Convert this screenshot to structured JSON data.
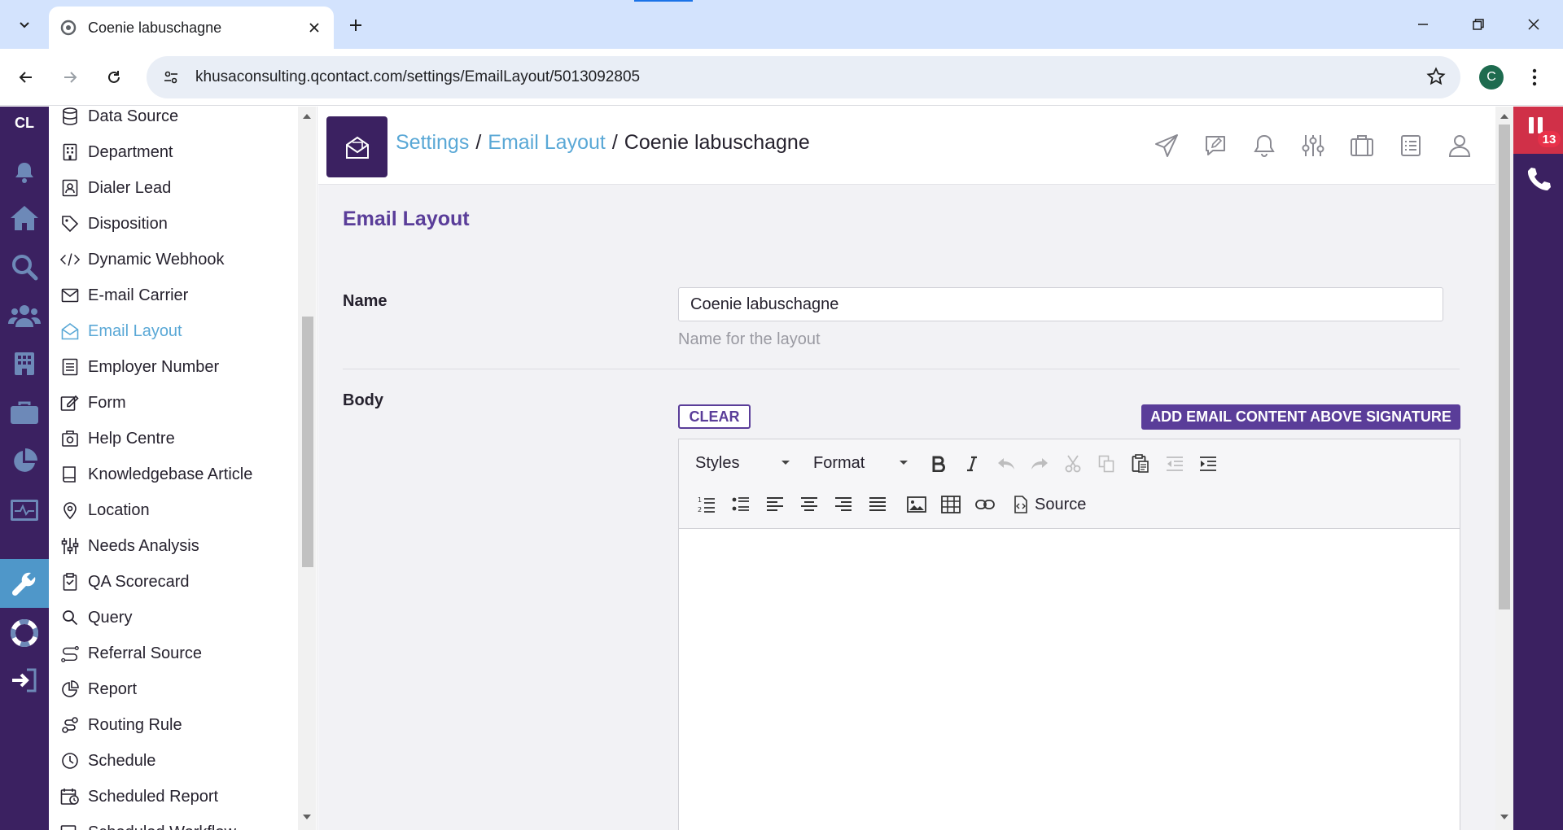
{
  "browser": {
    "tab_title": "Coenie labuschagne",
    "url": "khusaconsulting.qcontact.com/settings/EmailLayout/5013092805",
    "profile_initial": "C"
  },
  "rail": {
    "logo": "CL",
    "items": [
      "bell-icon",
      "home-icon",
      "search-icon",
      "people-icon",
      "building-icon",
      "briefcase-icon",
      "pie-chart-icon",
      "monitor-icon",
      "wrench-icon",
      "lifebuoy-icon",
      "logout-icon"
    ]
  },
  "menu": {
    "items": [
      {
        "label": "Data Source",
        "icon": "database-icon"
      },
      {
        "label": "Department",
        "icon": "building-icon"
      },
      {
        "label": "Dialer Lead",
        "icon": "contact-card-icon"
      },
      {
        "label": "Disposition",
        "icon": "tag-icon"
      },
      {
        "label": "Dynamic Webhook",
        "icon": "code-icon"
      },
      {
        "label": "E-mail Carrier",
        "icon": "envelope-icon"
      },
      {
        "label": "Email Layout",
        "icon": "envelope-open-icon",
        "active": true
      },
      {
        "label": "Employer Number",
        "icon": "list-icon"
      },
      {
        "label": "Form",
        "icon": "form-edit-icon"
      },
      {
        "label": "Help Centre",
        "icon": "help-centre-icon"
      },
      {
        "label": "Knowledgebase Article",
        "icon": "book-icon"
      },
      {
        "label": "Location",
        "icon": "map-pin-icon"
      },
      {
        "label": "Needs Analysis",
        "icon": "sliders-icon"
      },
      {
        "label": "QA Scorecard",
        "icon": "clipboard-icon"
      },
      {
        "label": "Query",
        "icon": "search-icon"
      },
      {
        "label": "Referral Source",
        "icon": "route-icon"
      },
      {
        "label": "Report",
        "icon": "pie-chart-icon"
      },
      {
        "label": "Routing Rule",
        "icon": "routing-icon"
      },
      {
        "label": "Schedule",
        "icon": "clock-icon"
      },
      {
        "label": "Scheduled Report",
        "icon": "calendar-clock-icon"
      },
      {
        "label": "Scheduled Workflow",
        "icon": "workflow-icon"
      }
    ]
  },
  "header": {
    "breadcrumb": {
      "settings": "Settings",
      "sep1": "/",
      "email_layout": "Email Layout",
      "sep2": "/",
      "current": "Coenie labuschagne"
    },
    "tools": [
      "send-icon",
      "message-edit-icon",
      "bell-icon",
      "sliders-icon",
      "briefcase-icon",
      "list-icon",
      "user-icon"
    ]
  },
  "form": {
    "title": "Email Layout",
    "name_label": "Name",
    "name_value": "Coenie labuschagne",
    "name_help": "Name for the layout",
    "body_label": "Body",
    "clear_label": "CLEAR",
    "add_content_label": "ADD EMAIL CONTENT ABOVE SIGNATURE"
  },
  "editor": {
    "styles_label": "Styles",
    "format_label": "Format",
    "source_label": "Source"
  },
  "phone": {
    "badge": "13"
  },
  "colors": {
    "brand_purple": "#3b2161",
    "accent_purple": "#5a3d99",
    "link_blue": "#5aa8d6",
    "alert_red": "#d03048"
  }
}
